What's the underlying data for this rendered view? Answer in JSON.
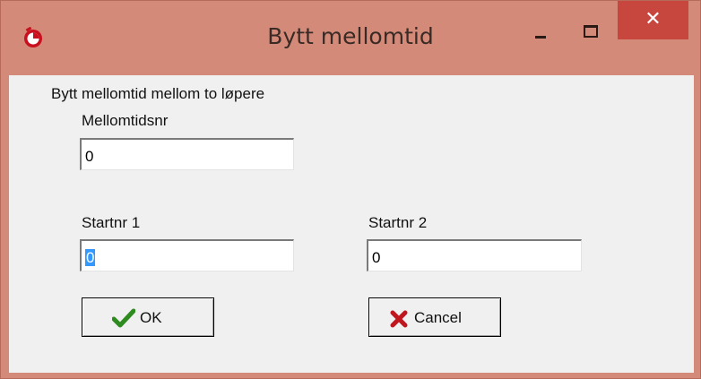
{
  "window": {
    "title": "Bytt mellomtid",
    "close_glyph": "✕"
  },
  "form": {
    "heading": "Bytt mellomtid mellom to løpere",
    "split_label": "Mellomtidsnr",
    "split_value": "0",
    "start1_label": "Startnr 1",
    "start1_value": "0",
    "start2_label": "Startnr 2",
    "start2_value": "0"
  },
  "buttons": {
    "ok_label": "OK",
    "cancel_label": "Cancel"
  },
  "icons": {
    "app": "stopwatch-icon",
    "ok": "checkmark-icon",
    "cancel": "cross-icon"
  },
  "colors": {
    "titlebar": "#d48a78",
    "close": "#c7463d",
    "client": "#f0f0f0",
    "selection": "#3399ff",
    "ok_check": "#2e8b1f",
    "cancel_x": "#c0171f"
  }
}
